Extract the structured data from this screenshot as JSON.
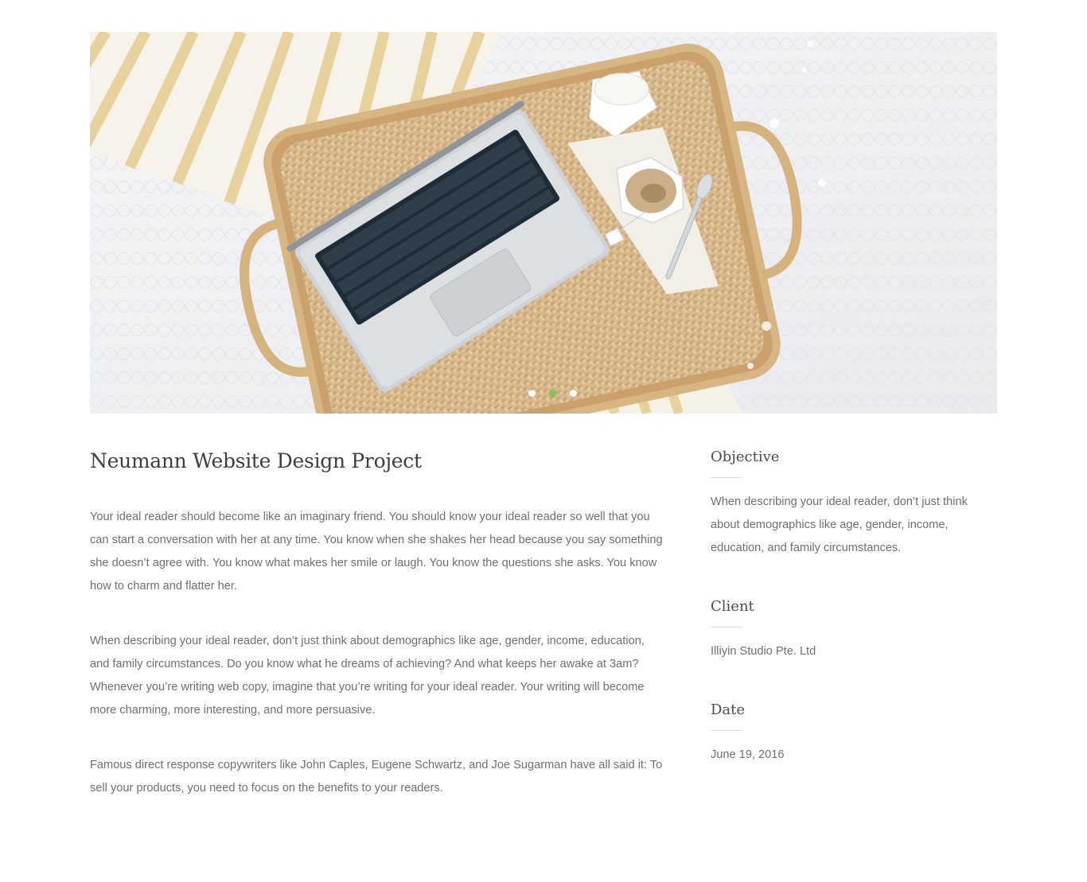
{
  "slider": {
    "image_alt": "Laptop, tea cup and milk jug on a wicker tray on a white bed",
    "dots": [
      {
        "label": "Slide 1",
        "active": false
      },
      {
        "label": "Slide 2",
        "active": true
      },
      {
        "label": "Slide 3",
        "active": false
      }
    ]
  },
  "project": {
    "title": "Neumann Website Design Project",
    "paragraphs": [
      "Your ideal reader should become like an imaginary friend. You should know your ideal reader so well that you can start a conversation with her at any time. You know when she shakes her head because you say something she doesn’t agree with. You know what makes her smile or laugh. You know the questions she asks. You know how to charm and flatter her.",
      "When describing your ideal reader, don’t just think about demographics like age, gender, income, education, and family circumstances. Do you know what he dreams of achieving? And what keeps her awake at 3am?\nWhenever you’re writing web copy, imagine that you’re writing for your ideal reader. Your writing will become more charming, more interesting, and more persuasive.",
      "Famous direct response copywriters like John Caples, Eugene Schwartz, and Joe Sugarman have all said it: To sell your products, you need to focus on the benefits to your readers."
    ]
  },
  "sidebar": {
    "objective": {
      "heading": "Objective",
      "text": "When describing your ideal reader, don’t just think about demographics like age, gender, income, education, and family circumstances."
    },
    "client": {
      "heading": "Client",
      "text": "Illiyin Studio Pte. Ltd"
    },
    "date": {
      "heading": "Date",
      "text": "June 19, 2016"
    }
  },
  "colors": {
    "accent": "#8cc152",
    "heading": "#3e3e3e",
    "body_text": "#6f6f6f"
  }
}
